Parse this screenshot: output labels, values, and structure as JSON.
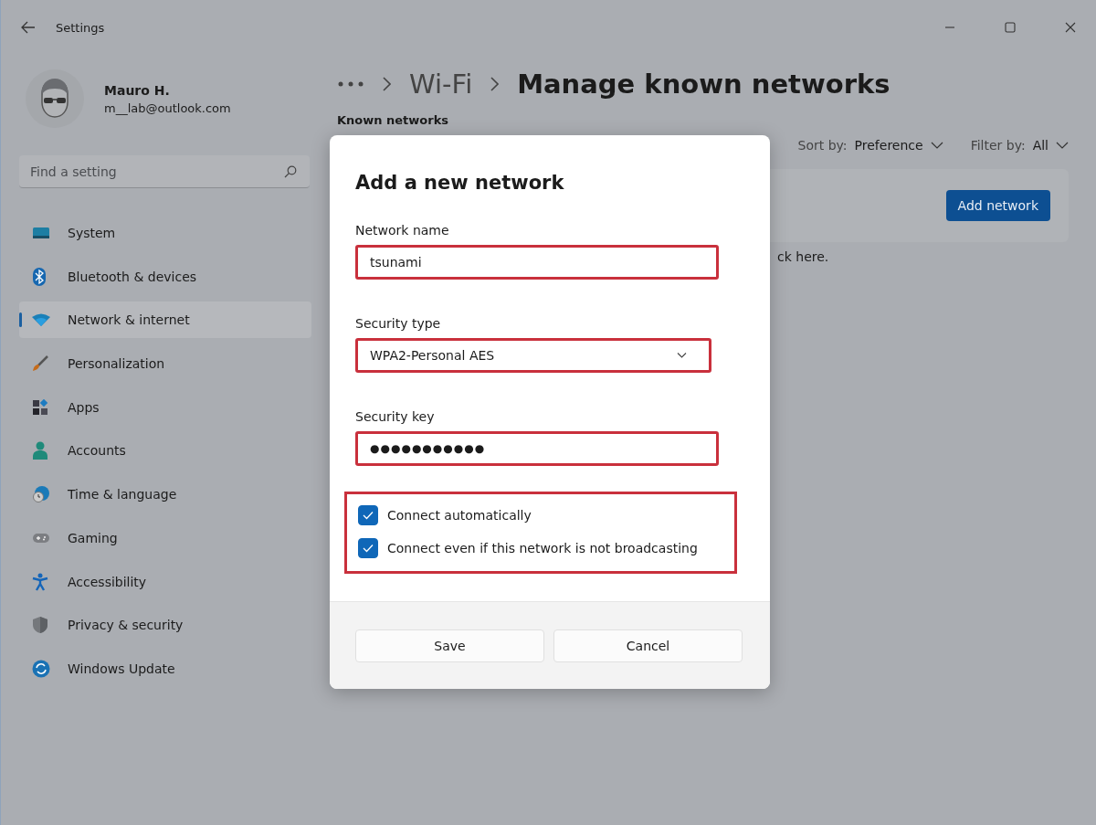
{
  "window": {
    "title": "Settings"
  },
  "profile": {
    "name": "Mauro H.",
    "email": "m__lab@outlook.com"
  },
  "search": {
    "placeholder": "Find a setting"
  },
  "nav": [
    {
      "label": "System",
      "selected": false
    },
    {
      "label": "Bluetooth & devices",
      "selected": false
    },
    {
      "label": "Network & internet",
      "selected": true
    },
    {
      "label": "Personalization",
      "selected": false
    },
    {
      "label": "Apps",
      "selected": false
    },
    {
      "label": "Accounts",
      "selected": false
    },
    {
      "label": "Time & language",
      "selected": false
    },
    {
      "label": "Gaming",
      "selected": false
    },
    {
      "label": "Accessibility",
      "selected": false
    },
    {
      "label": "Privacy & security",
      "selected": false
    },
    {
      "label": "Windows Update",
      "selected": false
    }
  ],
  "breadcrumb": [
    "Wi-Fi",
    "Manage known networks"
  ],
  "known_networks": {
    "heading": "Known networks",
    "sort_label": "Sort by:",
    "sort_value": "Preference",
    "filter_label": "Filter by:",
    "filter_value": "All",
    "add_button": "Add network",
    "hint": "ck here."
  },
  "dialog": {
    "title": "Add a new network",
    "fields": [
      {
        "label": "Network name",
        "kind": "text",
        "value": "tsunami",
        "highlighted": true
      },
      {
        "label": "Security type",
        "kind": "dropdown",
        "value": "WPA2-Personal AES",
        "highlighted": true
      },
      {
        "label": "Security key",
        "kind": "password",
        "value": "●●●●●●●●●●●",
        "highlighted": true
      }
    ],
    "options_highlighted": true,
    "options": [
      {
        "label": "Connect automatically",
        "checked": true
      },
      {
        "label": "Connect even if this network is not broadcasting",
        "checked": true
      }
    ],
    "buttons": [
      "Save",
      "Cancel"
    ]
  }
}
